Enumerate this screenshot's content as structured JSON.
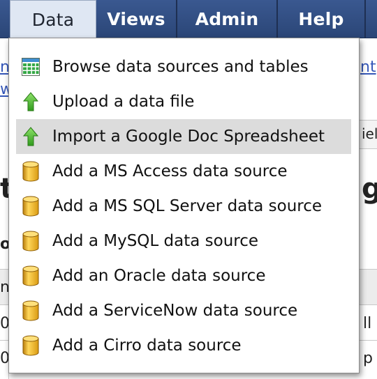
{
  "nav": {
    "tabs": [
      {
        "label": "Data",
        "active": true
      },
      {
        "label": "Views",
        "active": false
      },
      {
        "label": "Admin",
        "active": false
      },
      {
        "label": "Help",
        "active": false
      }
    ]
  },
  "background": {
    "link_left_1": "n",
    "link_left_2": "w",
    "link_right_1": "nt",
    "partial_right_box": "iel",
    "heading_left": "t",
    "heading_right": "g",
    "text_left": "o",
    "table_header_left": "n",
    "row1_left": "0",
    "row1_right": "ll",
    "row2_left": "0",
    "row2_right": "p"
  },
  "menu": {
    "items": [
      {
        "label": "Browse data sources and tables",
        "icon": "table-grid-icon"
      },
      {
        "label": "Upload a data file",
        "icon": "upload-arrow-icon"
      },
      {
        "label": "Import a Google Doc Spreadsheet",
        "icon": "upload-arrow-icon"
      },
      {
        "label": "Add a MS Access data source",
        "icon": "database-cylinder-icon"
      },
      {
        "label": "Add a MS SQL Server data source",
        "icon": "database-cylinder-icon"
      },
      {
        "label": "Add a MySQL data source",
        "icon": "database-cylinder-icon"
      },
      {
        "label": "Add an Oracle data source",
        "icon": "database-cylinder-icon"
      },
      {
        "label": "Add a ServiceNow data source",
        "icon": "database-cylinder-icon"
      },
      {
        "label": "Add a Cirro data source",
        "icon": "database-cylinder-icon"
      }
    ],
    "highlighted_index": 2
  },
  "colors": {
    "navbar": "#2f4c80",
    "active_tab": "#dfe7f3",
    "menu_highlight": "#dcdcdc",
    "database_icon": "#e5a91e",
    "upload_icon": "#46b42b",
    "grid_icon": "#2f9a3a"
  }
}
